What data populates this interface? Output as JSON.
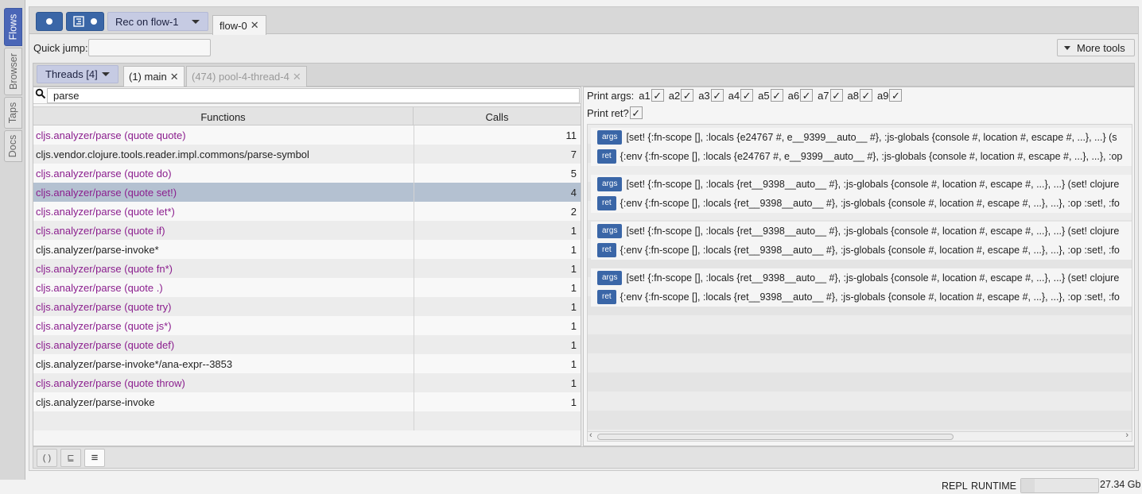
{
  "side_tabs": [
    {
      "label": "Flows",
      "active": true
    },
    {
      "label": "Browser",
      "active": false
    },
    {
      "label": "Taps",
      "active": false
    },
    {
      "label": "Docs",
      "active": false
    }
  ],
  "toolbar": {
    "record_icon": "record-dot-icon",
    "tree_icon": "flow-tree-icon",
    "rec_select": "Rec on flow-1",
    "flow_tab": "flow-0",
    "close_glyph": "✕"
  },
  "quick_jump": {
    "label": "Quick jump:",
    "value": ""
  },
  "more_tools": {
    "label": "More tools"
  },
  "threads": {
    "select_label": "Threads [4]",
    "tabs": [
      {
        "label": "(1) main",
        "active": true
      },
      {
        "label": "(474) pool-4-thread-4",
        "active": false
      }
    ]
  },
  "search": {
    "value": "parse"
  },
  "table": {
    "headers": {
      "functions": "Functions",
      "calls": "Calls"
    },
    "rows": [
      {
        "fn": "cljs.analyzer/parse (quote quote)",
        "calls": "11",
        "style": "purple"
      },
      {
        "fn": "cljs.vendor.clojure.tools.reader.impl.commons/parse-symbol",
        "calls": "7",
        "style": "dark"
      },
      {
        "fn": "cljs.analyzer/parse (quote do)",
        "calls": "5",
        "style": "purple"
      },
      {
        "fn": "cljs.analyzer/parse (quote set!)",
        "calls": "4",
        "style": "purple",
        "selected": true
      },
      {
        "fn": "cljs.analyzer/parse (quote let*)",
        "calls": "2",
        "style": "purple"
      },
      {
        "fn": "cljs.analyzer/parse (quote if)",
        "calls": "1",
        "style": "purple"
      },
      {
        "fn": "cljs.analyzer/parse-invoke*",
        "calls": "1",
        "style": "dark"
      },
      {
        "fn": "cljs.analyzer/parse (quote fn*)",
        "calls": "1",
        "style": "purple"
      },
      {
        "fn": "cljs.analyzer/parse (quote .)",
        "calls": "1",
        "style": "purple"
      },
      {
        "fn": "cljs.analyzer/parse (quote try)",
        "calls": "1",
        "style": "purple"
      },
      {
        "fn": "cljs.analyzer/parse (quote js*)",
        "calls": "1",
        "style": "purple"
      },
      {
        "fn": "cljs.analyzer/parse (quote def)",
        "calls": "1",
        "style": "purple"
      },
      {
        "fn": "cljs.analyzer/parse-invoke*/ana-expr--3853",
        "calls": "1",
        "style": "dark"
      },
      {
        "fn": "cljs.analyzer/parse (quote throw)",
        "calls": "1",
        "style": "purple"
      },
      {
        "fn": "cljs.analyzer/parse-invoke",
        "calls": "1",
        "style": "dark"
      }
    ]
  },
  "bottom_buttons": [
    {
      "glyph": "( )",
      "icon": "code-form-icon",
      "active": false
    },
    {
      "glyph": "⊑",
      "icon": "call-tree-icon",
      "active": false
    },
    {
      "glyph": "≡",
      "icon": "functions-list-icon",
      "active": true
    }
  ],
  "print_args": {
    "label": "Print args:",
    "args": [
      "a1",
      "a2",
      "a3",
      "a4",
      "a5",
      "a6",
      "a7",
      "a8",
      "a9"
    ],
    "check_glyph": "✓"
  },
  "print_ret": {
    "label": "Print ret?"
  },
  "results": [
    {
      "args": "[set! {:fn-scope [], :locals {e24767 #, e__9399__auto__ #}, :js-globals {console #, location #, escape #, ...}, ...} (s",
      "ret": "{:env {:fn-scope [], :locals {e24767 #, e__9399__auto__ #}, :js-globals {console #, location #, escape #, ...}, ...}, :op"
    },
    {
      "args": "[set! {:fn-scope [], :locals {ret__9398__auto__ #}, :js-globals {console #, location #, escape #, ...}, ...} (set! clojure",
      "ret": "{:env {:fn-scope [], :locals {ret__9398__auto__ #}, :js-globals {console #, location #, escape #, ...}, ...}, :op :set!, :fo"
    },
    {
      "args": "[set! {:fn-scope [], :locals {ret__9398__auto__ #}, :js-globals {console #, location #, escape #, ...}, ...} (set! clojure",
      "ret": "{:env {:fn-scope [], :locals {ret__9398__auto__ #}, :js-globals {console #, location #, escape #, ...}, ...}, :op :set!, :fo"
    },
    {
      "args": "[set! {:fn-scope [], :locals {ret__9398__auto__ #}, :js-globals {console #, location #, escape #, ...}, ...} (set! clojure",
      "ret": "{:env {:fn-scope [], :locals {ret__9398__auto__ #}, :js-globals {console #, location #, escape #, ...}, ...}, :op :set!, :fo"
    }
  ],
  "pill_labels": {
    "args": "args",
    "ret": "ret"
  },
  "status": {
    "repl": "REPL",
    "runtime": "RUNTIME",
    "memory": "27.34 Gb"
  },
  "colors": {
    "accent": "#3a66a7",
    "purple_fn": "#8b1e8e",
    "selected_row": "#b4c1d1",
    "select_bg": "#c6cbe3"
  }
}
